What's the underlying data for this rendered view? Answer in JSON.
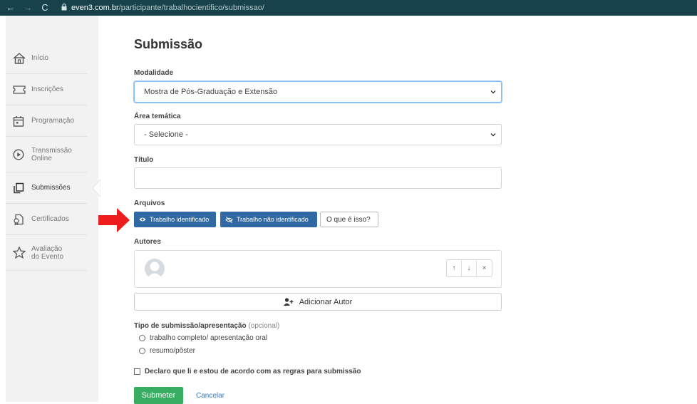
{
  "browser": {
    "back_icon": "←",
    "forward_icon": "→",
    "reload_icon": "C",
    "url_host": "even3.com.br",
    "url_path": "/participante/trabalhocientifico/submissao/"
  },
  "sidebar": {
    "items": [
      {
        "label": "Início",
        "icon": "home-icon"
      },
      {
        "label": "Inscrições",
        "icon": "ticket-icon"
      },
      {
        "label": "Programação",
        "icon": "calendar-icon"
      },
      {
        "label_line1": "Transmissão",
        "label_line2": "Online",
        "icon": "play-icon"
      },
      {
        "label": "Submissões",
        "icon": "copy-icon"
      },
      {
        "label": "Certificados",
        "icon": "certificate-icon"
      },
      {
        "label_line1": "Avaliação",
        "label_line2": "do Evento",
        "icon": "star-icon"
      }
    ]
  },
  "page": {
    "title": "Submissão",
    "modalidade_label": "Modalidade",
    "modalidade_value": "Mostra de Pós-Graduação e Extensão",
    "area_label": "Área temática",
    "area_value": "- Selecione -",
    "titulo_label": "Título",
    "titulo_value": "",
    "arquivos_label": "Arquivos",
    "btn_identificado": "Trabalho identificado",
    "btn_nao_identificado": "Trabalho não identificado",
    "btn_o_que": "O que é isso?",
    "autores_label": "Autores",
    "ctrl_up": "↑",
    "ctrl_down": "↓",
    "ctrl_remove": "×",
    "add_author": "Adicionar Autor",
    "tipo_label": "Tipo de submissão/apresentação",
    "tipo_opcional": "(opcional)",
    "radio_1": "trabalho completo/ apresentação oral",
    "radio_2": "resumo/pôster",
    "declaro": "Declaro que li e estou de acordo com as regras para submissão",
    "submit": "Submeter",
    "cancel": "Cancelar"
  },
  "colors": {
    "browser_bar": "#17414b",
    "primary_blue": "#3169a4",
    "submit_green": "#37ad61",
    "link_blue": "#3779b8",
    "annotation_red": "#ee1c1c"
  }
}
